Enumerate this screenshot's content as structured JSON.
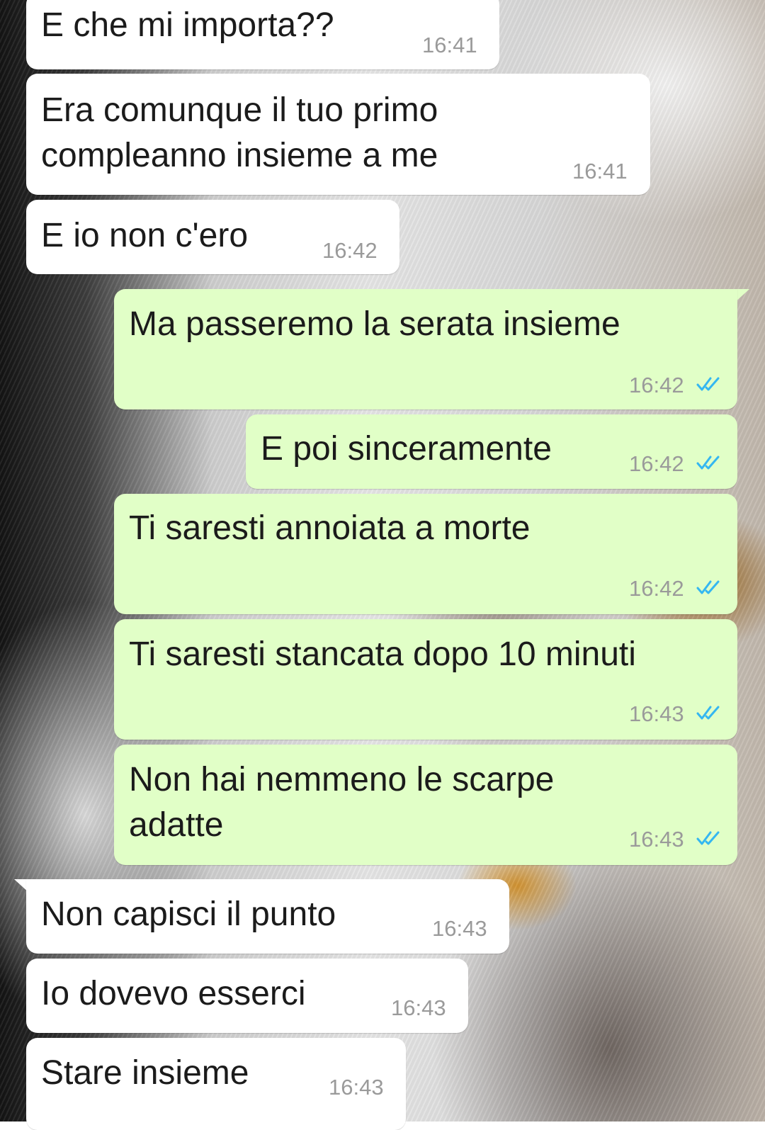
{
  "chat": {
    "messages": [
      {
        "direction": "incoming",
        "text": "E che mi importa??",
        "time": "16:41"
      },
      {
        "direction": "incoming",
        "text_lines": [
          "Era comunque il tuo primo",
          "compleanno insieme a me"
        ],
        "time": "16:41"
      },
      {
        "direction": "incoming",
        "text": "E io non c'ero",
        "time": "16:42"
      },
      {
        "direction": "outgoing",
        "text": "Ma passeremo la serata insieme",
        "time": "16:42",
        "status": "read"
      },
      {
        "direction": "outgoing",
        "text": "E poi sinceramente",
        "time": "16:42",
        "status": "read"
      },
      {
        "direction": "outgoing",
        "text": "Ti saresti annoiata a morte",
        "time": "16:42",
        "status": "read"
      },
      {
        "direction": "outgoing",
        "text": "Ti saresti stancata dopo 10 minuti",
        "time": "16:43",
        "status": "read"
      },
      {
        "direction": "outgoing",
        "text_lines": [
          "Non hai nemmeno le scarpe",
          "adatte"
        ],
        "time": "16:43",
        "status": "read"
      },
      {
        "direction": "incoming",
        "text": "Non capisci il punto",
        "time": "16:43"
      },
      {
        "direction": "incoming",
        "text": "Io dovevo esserci",
        "time": "16:43"
      },
      {
        "direction": "incoming",
        "text": "Stare insieme",
        "time": "16:43"
      }
    ]
  },
  "colors": {
    "incoming_bubble": "#ffffff",
    "outgoing_bubble": "#e1ffc7",
    "read_ticks": "#34b7f1",
    "timestamp": "#9a9a9a"
  },
  "icons": {
    "read_receipt": "double-check-icon"
  }
}
